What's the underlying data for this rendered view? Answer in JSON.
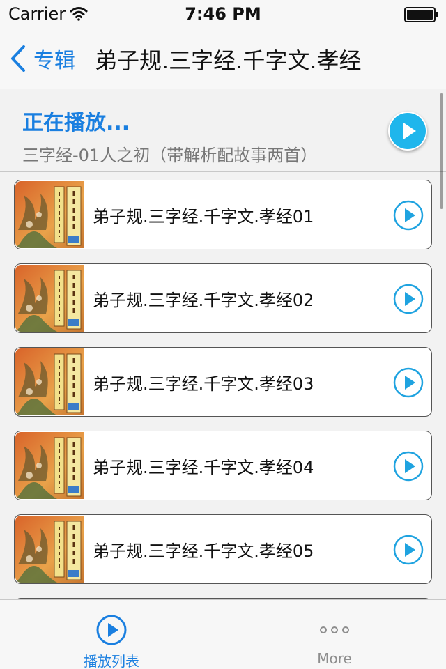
{
  "status_bar": {
    "carrier": "Carrier",
    "time": "7:46 PM",
    "icons": [
      "wifi-icon",
      "battery-icon"
    ]
  },
  "nav": {
    "back_label": "专辑",
    "title": "弟子规.三字经.千字文.孝经",
    "accent_color": "#1a7fe0"
  },
  "now_playing": {
    "heading": "正在播放...",
    "track": "三字经-01人之初（带解析配故事两首）",
    "button_color": "#1fb6ec"
  },
  "tracks": [
    {
      "title": "弟子规.三字经.千字文.孝经01"
    },
    {
      "title": "弟子规.三字经.千字文.孝经02"
    },
    {
      "title": "弟子规.三字经.千字文.孝经03"
    },
    {
      "title": "弟子规.三字经.千字文.孝经04"
    },
    {
      "title": "弟子规.三字经.千字文.孝经05"
    },
    {
      "title": ""
    }
  ],
  "tab_bar": {
    "tabs": [
      {
        "label": "播放列表",
        "icon": "play-circle-icon",
        "selected": true
      },
      {
        "label": "More",
        "icon": "more-dots-icon",
        "selected": false
      }
    ]
  }
}
